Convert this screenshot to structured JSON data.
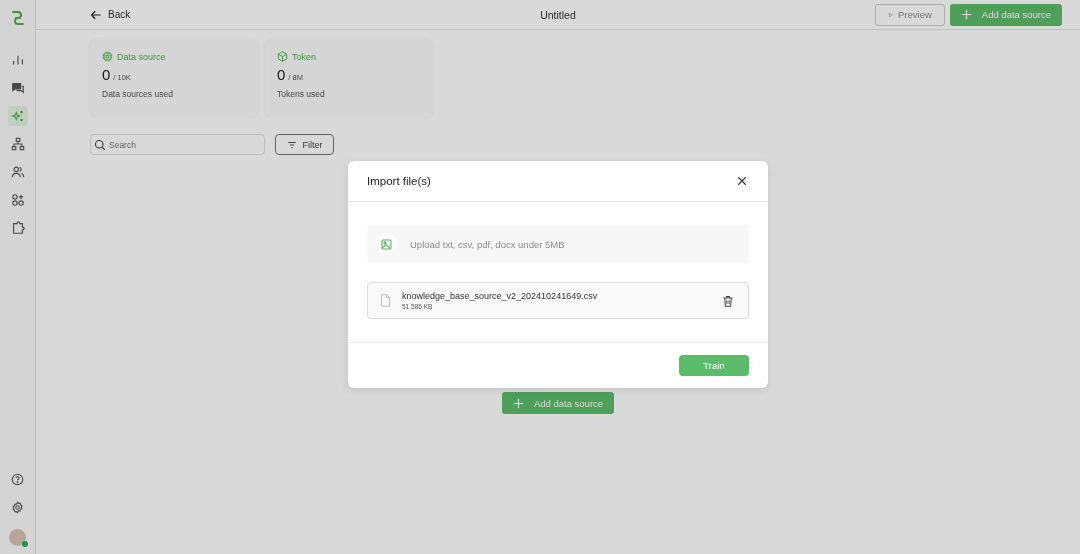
{
  "sidebar": {
    "nav": [
      {
        "selected": false
      },
      {
        "selected": false
      },
      {
        "selected": true
      },
      {
        "selected": false
      },
      {
        "selected": false
      },
      {
        "selected": false
      },
      {
        "selected": false
      }
    ]
  },
  "header": {
    "back": "Back",
    "title": "Untitled",
    "preview": "Preview",
    "add": "Add data source"
  },
  "stats": [
    {
      "label": "Data source",
      "value": "0",
      "limit": "/ 10K",
      "caption": "Data sources used"
    },
    {
      "label": "Token",
      "value": "0",
      "limit": "/ 8M",
      "caption": "Tokens used"
    }
  ],
  "search": {
    "placeholder": "Search"
  },
  "filter": "Filter",
  "empty_add": "Add data source",
  "dialog": {
    "title": "Import file(s)",
    "upload_hint": "Upload txt, csv, pdf, docx under 5MB",
    "files": [
      {
        "name": "knowledge_base_source_v2_202410241649.csv",
        "size": "51.586 KB"
      }
    ],
    "train": "Train"
  }
}
